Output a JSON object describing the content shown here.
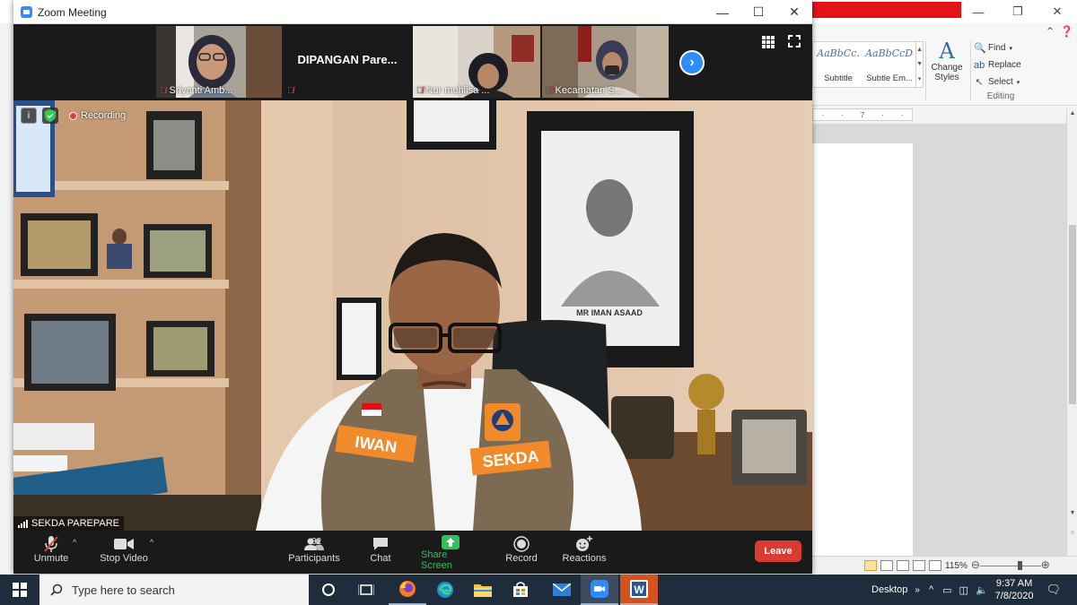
{
  "zoom": {
    "window_title": "Zoom Meeting",
    "participants_thumbs": [
      {
        "name": "Sriyanti Amb..."
      },
      {
        "name": "",
        "display_name": "DIPANGAN Pare..."
      },
      {
        "name": "Nur muhlisa ..."
      },
      {
        "name": "Kecamatan S..."
      }
    ],
    "main_video": {
      "recording_label": "Recording",
      "speaker_name": "SEKDA PAREPARE",
      "vest_name": "IWAN",
      "vest_title": "SEKDA",
      "portrait_caption": "MR IMAN ASAAD"
    },
    "toolbar": {
      "unmute": "Unmute",
      "stop_video": "Stop Video",
      "participants": "Participants",
      "participants_count": "32",
      "chat": "Chat",
      "share_screen": "Share Screen",
      "record": "Record",
      "reactions": "Reactions",
      "leave": "Leave"
    }
  },
  "word": {
    "styles": [
      {
        "sample": "AaBbCc.",
        "name": "Subtitle"
      },
      {
        "sample": "AaBbCcDc",
        "name": "Subtle Em..."
      }
    ],
    "change_styles": "Change Styles",
    "editing": {
      "find": "Find",
      "replace": "Replace",
      "select": "Select",
      "group_label": "Editing"
    },
    "ruler_mark": "7",
    "zoom_level": "115%"
  },
  "taskbar": {
    "search_placeholder": "Type here to search",
    "desktop_label": "Desktop",
    "time": "9:37 AM",
    "date": "7/8/2020"
  },
  "colors": {
    "zoom_blue": "#2d8cff",
    "leave_red": "#d93a32",
    "share_green": "#33c05a",
    "taskbar": "#1e2c3c"
  }
}
